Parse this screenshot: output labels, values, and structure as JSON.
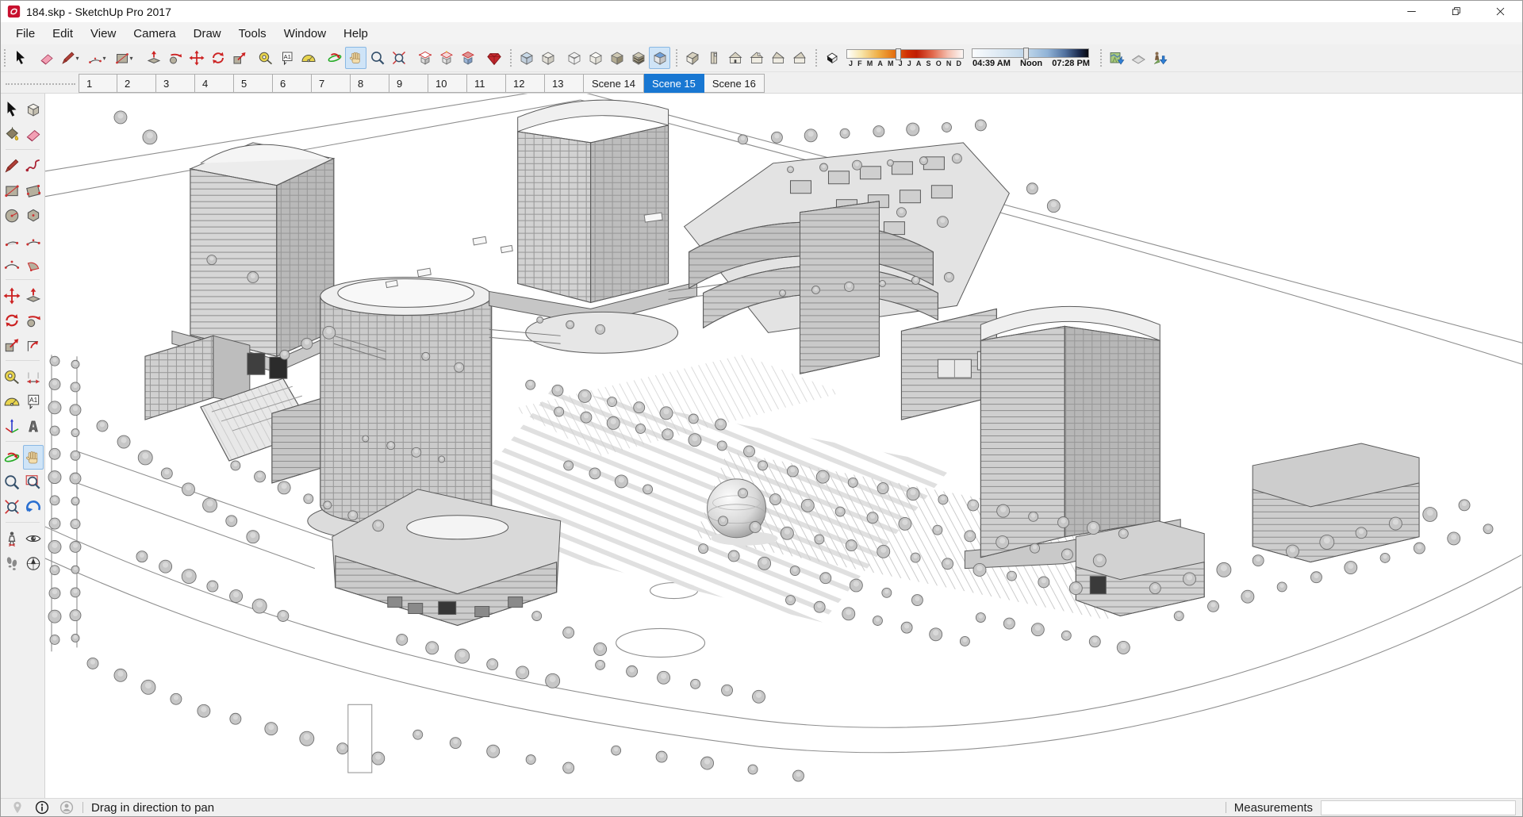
{
  "window": {
    "title": "184.skp - SketchUp Pro 2017",
    "controls": [
      {
        "name": "minimize-button",
        "icon": "min-icon"
      },
      {
        "name": "restore-button",
        "icon": "restore-icon"
      },
      {
        "name": "close-button",
        "icon": "close-icon"
      }
    ]
  },
  "colors": {
    "active_scene_tab": "#1877d2",
    "active_tool_highlight": "#cfe4f7",
    "titlebar": "#ffffff",
    "chrome": "#f0f0f0",
    "viewport_background": "#ffffff"
  },
  "menu": {
    "items": [
      "File",
      "Edit",
      "View",
      "Camera",
      "Draw",
      "Tools",
      "Window",
      "Help"
    ]
  },
  "toolbar": {
    "groups": [
      {
        "name": "select",
        "toolbar_start": true,
        "items": [
          {
            "name": "select-tool-button",
            "icon": "select-icon"
          }
        ]
      },
      {
        "name": "draw-edit",
        "items": [
          {
            "name": "eraser-tool-button",
            "icon": "eraser-icon"
          },
          {
            "name": "line-tool-button",
            "icon": "line-icon",
            "dropdown": true
          },
          {
            "name": "arc-tool-button",
            "icon": "arc-icon",
            "dropdown": true
          },
          {
            "name": "rectangle-tool-button",
            "icon": "rectangle-icon",
            "dropdown": true
          }
        ]
      },
      {
        "name": "modify",
        "items": [
          {
            "name": "pushpull-tool-button",
            "icon": "pushpull-icon"
          },
          {
            "name": "followme-tool-button",
            "icon": "followme-icon"
          },
          {
            "name": "move-tool-button",
            "icon": "move-icon"
          },
          {
            "name": "rotate-tool-button",
            "icon": "rotate-icon"
          },
          {
            "name": "scale-tool-button",
            "icon": "scale-icon"
          }
        ]
      },
      {
        "name": "construction",
        "items": [
          {
            "name": "tape-measure-button",
            "icon": "tape-icon"
          },
          {
            "name": "text-tool-button",
            "icon": "text-icon"
          },
          {
            "name": "protractor-tool-button",
            "icon": "protractor-icon"
          }
        ]
      },
      {
        "name": "camera",
        "items": [
          {
            "name": "orbit-tool-button",
            "icon": "orbit-icon"
          },
          {
            "name": "pan-tool-button",
            "icon": "pan-icon",
            "active": true
          },
          {
            "name": "zoom-tool-button",
            "icon": "zoom-icon"
          },
          {
            "name": "zoom-extents-button",
            "icon": "zoom-extents-icon"
          }
        ]
      },
      {
        "name": "sections",
        "items": [
          {
            "name": "section-plane-button",
            "icon": "section-plane-icon"
          },
          {
            "name": "display-section-planes-button",
            "icon": "section-display-icon"
          },
          {
            "name": "display-section-cuts-button",
            "icon": "section-cut-icon"
          }
        ]
      },
      {
        "name": "ruby",
        "items": [
          {
            "name": "ruby-console-button",
            "icon": "ruby-icon"
          }
        ]
      },
      {
        "name": "edge-styles",
        "toolbar_start": true,
        "items": [
          {
            "name": "xray-style-button",
            "icon": "xray-icon"
          },
          {
            "name": "back-edges-style-button",
            "icon": "backedges-icon"
          }
        ]
      },
      {
        "name": "face-styles",
        "items": [
          {
            "name": "wireframe-style-button",
            "icon": "wireframe-icon"
          },
          {
            "name": "hidden-line-style-button",
            "icon": "hiddenline-icon"
          },
          {
            "name": "shaded-style-button",
            "icon": "shaded-icon"
          },
          {
            "name": "shaded-textures-style-button",
            "icon": "textured-icon"
          },
          {
            "name": "monochrome-style-button",
            "icon": "mono-icon",
            "active": true
          }
        ]
      },
      {
        "name": "views",
        "toolbar_start": true,
        "items": [
          {
            "name": "iso-view-button",
            "icon": "view-iso-icon"
          },
          {
            "name": "top-view-button",
            "icon": "view-top-icon"
          },
          {
            "name": "front-view-button",
            "icon": "view-front-icon"
          },
          {
            "name": "back-view-button",
            "icon": "view-back-icon"
          },
          {
            "name": "left-view-button",
            "icon": "view-left-icon"
          },
          {
            "name": "right-view-button",
            "icon": "view-right-icon"
          }
        ]
      },
      {
        "name": "shadows",
        "toolbar_start": true,
        "items": [
          {
            "name": "shadow-settings-button",
            "icon": "shadow-settings-icon"
          },
          {
            "widget": "month-slider",
            "handle": 42
          },
          {
            "widget": "time-slider",
            "handle": 44
          }
        ]
      },
      {
        "name": "location",
        "toolbar_start": true,
        "items": [
          {
            "name": "add-location-button",
            "icon": "add-location-icon"
          },
          {
            "name": "toggle-terrain-button",
            "icon": "terrain-icon"
          },
          {
            "name": "photo-textures-button",
            "icon": "phototextures-icon"
          }
        ]
      }
    ],
    "shadows": {
      "months": [
        "J",
        "F",
        "M",
        "A",
        "M",
        "J",
        "J",
        "A",
        "S",
        "O",
        "N",
        "D"
      ],
      "time_start": "04:39 AM",
      "time_noon": "Noon",
      "time_end": "07:28 PM"
    }
  },
  "scene_tabs": {
    "tabs": [
      "1",
      "2",
      "3",
      "4",
      "5",
      "6",
      "7",
      "8",
      "9",
      "10",
      "11",
      "12",
      "13",
      "Scene 14",
      "Scene 15",
      "Scene 16"
    ],
    "active": "Scene 15"
  },
  "palette": {
    "rows": [
      [
        {
          "name": "select-tool",
          "icon": "select-icon"
        },
        {
          "name": "make-component-tool",
          "icon": "component-icon"
        }
      ],
      [
        {
          "name": "paint-bucket-tool",
          "icon": "paintbucket-icon"
        },
        {
          "name": "eraser-tool",
          "icon": "eraser-icon"
        }
      ],
      "separator",
      [
        {
          "name": "line-tool",
          "icon": "line-icon"
        },
        {
          "name": "freehand-tool",
          "icon": "freehand-icon"
        }
      ],
      [
        {
          "name": "rectangle-tool",
          "icon": "rectangle-icon"
        },
        {
          "name": "rotated-rectangle-tool",
          "icon": "rotrect-icon"
        }
      ],
      [
        {
          "name": "circle-tool",
          "icon": "circle-icon"
        },
        {
          "name": "polygon-tool",
          "icon": "polygon-icon"
        }
      ],
      [
        {
          "name": "arc-tool",
          "icon": "arc2-icon"
        },
        {
          "name": "two-point-arc-tool",
          "icon": "arc-icon"
        }
      ],
      [
        {
          "name": "three-point-arc-tool",
          "icon": "arc3-icon"
        },
        {
          "name": "pie-tool",
          "icon": "pie-icon"
        }
      ],
      "separator",
      [
        {
          "name": "move-tool",
          "icon": "move-icon"
        },
        {
          "name": "pushpull-tool",
          "icon": "pushpull-icon"
        }
      ],
      [
        {
          "name": "rotate-tool",
          "icon": "rotate-icon"
        },
        {
          "name": "followme-tool",
          "icon": "followme-icon"
        }
      ],
      [
        {
          "name": "scale-tool",
          "icon": "scale-icon"
        },
        {
          "name": "offset-tool",
          "icon": "offset-icon"
        }
      ],
      "separator",
      [
        {
          "name": "tape-measure-tool",
          "icon": "tape-icon"
        },
        {
          "name": "dimension-tool",
          "icon": "dimension-icon"
        }
      ],
      [
        {
          "name": "protractor-tool",
          "icon": "protractor-icon"
        },
        {
          "name": "text-tool",
          "icon": "text-icon"
        }
      ],
      [
        {
          "name": "axes-tool",
          "icon": "axes-icon"
        },
        {
          "name": "3d-text-tool",
          "icon": "text3d-icon"
        }
      ],
      "separator",
      [
        {
          "name": "orbit-tool",
          "icon": "orbit-icon"
        },
        {
          "name": "pan-tool",
          "icon": "pan-icon",
          "active": true
        }
      ],
      [
        {
          "name": "zoom-tool",
          "icon": "zoom-icon"
        },
        {
          "name": "zoom-window-tool",
          "icon": "zoomwindow-icon"
        }
      ],
      [
        {
          "name": "zoom-extents-tool",
          "icon": "zoom-extents-icon"
        },
        {
          "name": "previous-view-tool",
          "icon": "previous-icon"
        }
      ],
      "separator",
      [
        {
          "name": "position-camera-tool",
          "icon": "poscam-icon"
        },
        {
          "name": "look-around-tool",
          "icon": "look-icon"
        }
      ],
      [
        {
          "name": "walk-tool",
          "icon": "walk-icon"
        },
        {
          "name": "navigation-tool",
          "icon": "nav-icon"
        }
      ]
    ]
  },
  "statusbar": {
    "icons": [
      {
        "name": "geolocation-status-icon",
        "icon": "geoloc-icon"
      },
      {
        "name": "credits-info-icon",
        "icon": "help-icon"
      },
      {
        "name": "sign-in-icon",
        "icon": "account-icon"
      }
    ],
    "message": "Drag in direction to pan",
    "measurements_label": "Measurements",
    "measurements_value": ""
  }
}
